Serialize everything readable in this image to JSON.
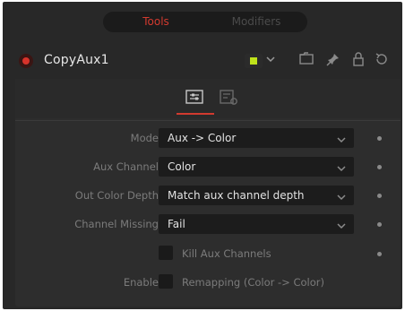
{
  "tabs": {
    "tools": "Tools",
    "modifiers": "Modifiers"
  },
  "node": {
    "name": "CopyAux1",
    "status_color": "#d8332b",
    "chip_color": "#bfe21a"
  },
  "header_icons": [
    "chevron-down-icon",
    "folder-icon",
    "pin-icon",
    "lock-icon",
    "reset-icon"
  ],
  "subtabs": [
    "controls-tab-icon",
    "settings-tab-icon"
  ],
  "controls": {
    "mode": {
      "label": "Mode",
      "value": "Aux -> Color"
    },
    "aux_channel": {
      "label": "Aux Channel",
      "value": "Color"
    },
    "out_color_depth": {
      "label": "Out Color Depth",
      "value": "Match aux channel depth"
    },
    "channel_missing": {
      "label": "Channel Missing",
      "value": "Fail"
    },
    "kill_aux": {
      "label": "Kill Aux Channels"
    },
    "enable_remapping": {
      "label": "Enable",
      "check_label": "Remapping (Color -> Color)"
    }
  },
  "accent_color": "#d23a2f"
}
